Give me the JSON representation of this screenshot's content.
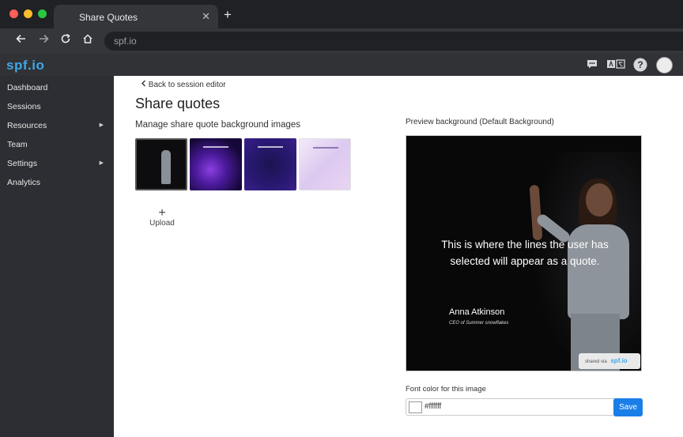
{
  "browser": {
    "tab_title": "Share Quotes",
    "tab_close": "✕",
    "new_tab": "+",
    "url": "spf.io",
    "traffic_colors": [
      "#ff5f57",
      "#febc2e",
      "#28c840"
    ]
  },
  "app": {
    "logo": "spf.io",
    "header_icons": [
      "chat-icon",
      "translate-icon",
      "help-icon",
      "avatar"
    ]
  },
  "sidebar": {
    "items": [
      {
        "label": "Dashboard",
        "has_submenu": false
      },
      {
        "label": "Sessions",
        "has_submenu": false
      },
      {
        "label": "Resources",
        "has_submenu": true
      },
      {
        "label": "Team",
        "has_submenu": false
      },
      {
        "label": "Settings",
        "has_submenu": true
      },
      {
        "label": "Analytics",
        "has_submenu": false
      }
    ]
  },
  "main": {
    "back_link": "Back to session editor",
    "title": "Share quotes",
    "subtitle": "Manage share quote background images",
    "upload_label": "Upload",
    "upload_plus": "+",
    "preview_label": "Preview background (Default Background)",
    "preview": {
      "quote": "This is where the lines the user has selected will appear as a quote.",
      "author": "Anna Atkinson",
      "author_role": "CEO of Summer snowflakes",
      "badge_text": "shared via",
      "badge_logo": "spf.io"
    },
    "font_color_label": "Font color for this image",
    "font_color_value": "#ffffff",
    "save_label": "Save"
  }
}
